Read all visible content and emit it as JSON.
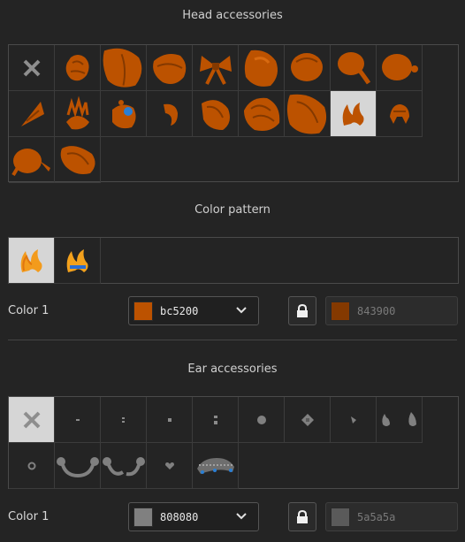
{
  "head": {
    "title": "Head accessories",
    "items": [
      "none",
      "pigtail-bun",
      "large-bun",
      "ribbon-bun",
      "bow",
      "round-bun",
      "side-bun",
      "drop-bun",
      "side-curl",
      "horn",
      "tiara",
      "blue-flower",
      "hair-clip",
      "round-clip",
      "ponytail",
      "big-bun",
      "flame-clip",
      "helmet",
      "side-drop",
      "side-fold"
    ],
    "selected_index": 16
  },
  "pattern": {
    "title": "Color pattern",
    "items": [
      "pattern-a",
      "pattern-b"
    ],
    "selected_index": 0
  },
  "head_color": {
    "label": "Color 1",
    "value": "bc5200",
    "value_color": "#bc5200",
    "locked_value": "843900",
    "locked_color": "#843900"
  },
  "ear": {
    "title": "Ear accessories",
    "items": [
      "none",
      "dash",
      "colon",
      "dot",
      "double-dot",
      "round-stud",
      "cross-stud",
      "small-stud",
      "drop-earrings",
      "ring",
      "headphones-a",
      "headphones-b",
      "heart",
      "beaded-chain"
    ],
    "selected_index": 0
  },
  "ear_color": {
    "label": "Color 1",
    "value": "808080",
    "value_color": "#808080",
    "locked_value": "5a5a5a",
    "locked_color": "#5a5a5a"
  }
}
